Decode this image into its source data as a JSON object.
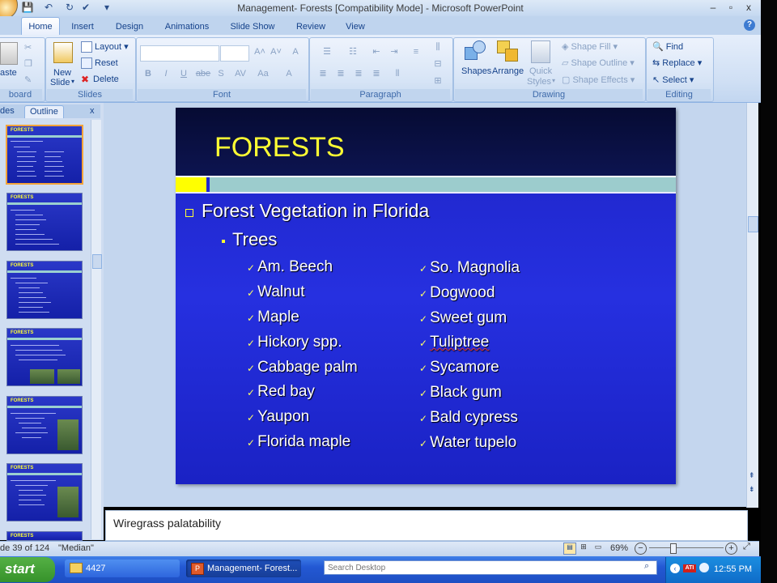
{
  "window": {
    "title": "Management- Forests [Compatibility Mode] - Microsoft PowerPoint",
    "minimize": "–",
    "restore": "▫",
    "close": "x"
  },
  "qat": {
    "save": "💾",
    "undo": "↶",
    "redo": "↻",
    "check": "✔",
    "more": "▾"
  },
  "tabs": [
    "Home",
    "Insert",
    "Design",
    "Animations",
    "Slide Show",
    "Review",
    "View"
  ],
  "help": "?",
  "ribbon": {
    "clipboard": {
      "paste": "aste",
      "label": "board"
    },
    "slides": {
      "new_slide_1": "New",
      "new_slide_2": "Slide",
      "layout": "Layout",
      "reset": "Reset",
      "delete": "Delete",
      "label": "Slides"
    },
    "font": {
      "bold": "B",
      "italic": "I",
      "underline": "U",
      "strike": "abe",
      "shadow": "S",
      "spacing": "AV",
      "case": "Aa",
      "color": "A",
      "grow": "A˄",
      "shrink": "A˅",
      "clear": "A",
      "label": "Font"
    },
    "paragraph": {
      "label": "Paragraph"
    },
    "drawing": {
      "shapes": "Shapes",
      "arrange": "Arrange",
      "quick_styles_1": "Quick",
      "quick_styles_2": "Styles",
      "shape_fill": "Shape Fill",
      "shape_outline": "Shape Outline",
      "shape_effects": "Shape Effects",
      "label": "Drawing"
    },
    "editing": {
      "find": "Find",
      "replace": "Replace",
      "select": "Select",
      "label": "Editing"
    }
  },
  "pane": {
    "tab_slides": "des",
    "tab_outline": "Outline",
    "close": "x",
    "thumbnail_title": "FORESTS"
  },
  "slide": {
    "title": "FORESTS",
    "bullet1": "Forest Vegetation in Florida",
    "bullet2": "Trees",
    "left_items": [
      "Am. Beech",
      "Walnut",
      "Maple",
      "Hickory spp.",
      "Cabbage palm",
      "Red bay",
      "Yaupon",
      "Florida maple"
    ],
    "right_items": [
      "So. Magnolia",
      "Dogwood",
      "Sweet gum",
      "Tuliptree",
      "Sycamore",
      "Black gum",
      "Bald cypress",
      "Water tupelo"
    ],
    "check": "✓"
  },
  "notes": "Wiregrass palatability",
  "status": {
    "slide_of": "de 39 of 124",
    "theme": "\"Median\"",
    "zoom": "69%"
  },
  "taskbar": {
    "start": "start",
    "folder": "4427",
    "ppt": "Management- Forest...",
    "search_placeholder": "Search Desktop",
    "clock": "12:55 PM"
  },
  "colors": {
    "slide_title": "#ffff33",
    "slide_bg": "#2630e0",
    "header_bar": "#9ccccd",
    "accent_block": "#ffff00"
  }
}
